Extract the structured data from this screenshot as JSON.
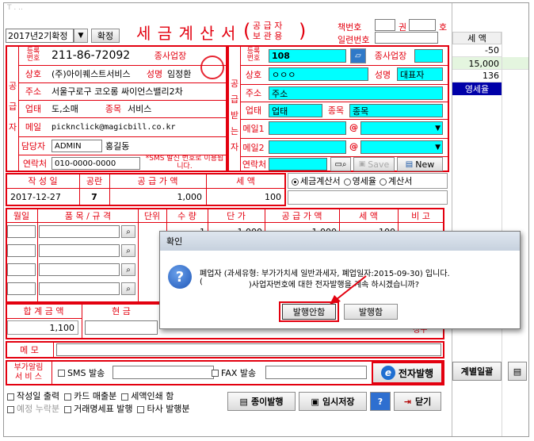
{
  "top_strip": "T     .    ..  ",
  "header": {
    "year_select": "2017년2기확정",
    "confirm_btn": "확정",
    "title": "세 금 계 산 서",
    "paren_l": "(",
    "paren_r": ")",
    "subtitle_1": "공 급 자",
    "subtitle_2": "보 관 용",
    "book_no_label": "책번호",
    "kwon": "권",
    "ho": "호",
    "serial_label": "일련번호"
  },
  "supplier": {
    "side_label": [
      "공",
      "급",
      "자"
    ],
    "reg_no_label": "등록\n번호",
    "reg_no": "211-86-72092",
    "branch_label": "종사업장",
    "name_label": "상호",
    "name": "(주)아이퀘스트서비스",
    "rep_label": "성명",
    "rep": "임정환",
    "addr_label": "주소",
    "addr": "서울구로구 코오롱 싸이언스밸리2차",
    "biz_label": "업태",
    "biz": "도,소매",
    "item_label": "종목",
    "item": "서비스",
    "mail_label": "메일",
    "mail": "picknclick@magicbill.co.kr",
    "manager_label": "담당자",
    "manager_id": "ADMIN",
    "manager_name": "홍길동",
    "contact_label": "연락처",
    "contact": "010-0000-0000",
    "sms_note": "*SMS 발신 번호로 이용됩니다."
  },
  "receiver": {
    "side_label": [
      "공",
      "급",
      "받",
      "는",
      "자"
    ],
    "reg_no_label": "등록\n번호",
    "reg_no": "108",
    "branch_label": "종사업장",
    "name_label": "상호",
    "name": "ㅇㅇㅇ",
    "rep_label": "성명",
    "rep": "대표자",
    "addr_label": "주소",
    "addr": "주소",
    "biz_label": "업태",
    "biz": "업태",
    "item_label": "종목",
    "item": "종목",
    "mail1_label": "메일1",
    "mail2_label": "메일2",
    "at": "@",
    "contact_label": "연락처",
    "save_btn": "Save",
    "new_btn": "New"
  },
  "summary": {
    "date_label": "작 성 일",
    "blank_label": "공란",
    "supply_label": "공 급 가 액",
    "tax_label": "세    액",
    "date": "2017-12-27",
    "blank": "7",
    "supply": "1,000",
    "tax": "100",
    "radio_tax": "세금계산서",
    "radio_zero": "영세율",
    "radio_bill": "계산서"
  },
  "items_table": {
    "headers": [
      "월일",
      "품 목 / 규 격",
      "단위",
      "수 량",
      "단 가",
      "공 급 가 액",
      "세 액",
      "비 고"
    ],
    "row1": {
      "qty": "1",
      "price": "1,000",
      "supply": "1,000",
      "tax": "100"
    }
  },
  "totals": {
    "total_label": "합 계 금 액",
    "cash_label": "현    금",
    "total": "1,100",
    "claim": "청구"
  },
  "memo_label": "메   모",
  "notify": {
    "label": "부가알림\n서 비 스",
    "sms": "SMS 발송",
    "fax": "FAX 발송",
    "e_issue_btn": "전자발행"
  },
  "options": {
    "row1": [
      "작성일 출력",
      "카드 매출분",
      "세액인쇄 함"
    ],
    "row2": [
      "예정 누락분",
      "거래명세표 발행",
      "타사 발행분"
    ],
    "paper_btn": "종이발행",
    "temp_save_btn": "임시저장",
    "help_btn": "?",
    "close_btn": "닫기"
  },
  "right_panel": {
    "header": "세 액",
    "values": [
      "-50",
      "15,000",
      "136"
    ],
    "badge": "영세율",
    "bottom_btn": "계별일괄"
  },
  "dialog": {
    "title": "확인",
    "line1": "폐업자 (과세유형: 부가가치세 일반과세자, 폐업일자:2015-09-30) 입니다.",
    "line2_pre": "(",
    "line2_post": ")사업자번호에 대한 전자발행을 계속 하시겠습니까?",
    "no_btn": "발행안함",
    "yes_btn": "발행함"
  },
  "colors": {
    "red": "#e3000f",
    "cyan": "#00ffff",
    "navy": "#0000a8",
    "dark_red": "#b00000"
  }
}
